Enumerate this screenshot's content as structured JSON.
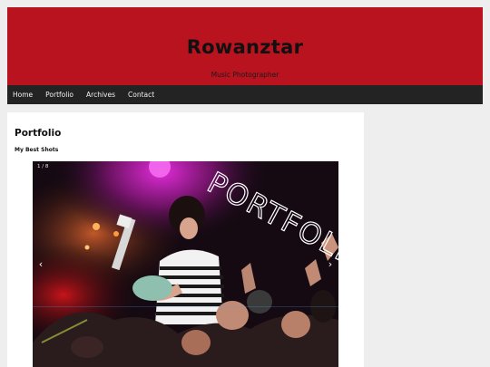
{
  "site": {
    "title": "Rowanztar",
    "tagline": "Music Photographer"
  },
  "nav": {
    "items": [
      {
        "label": "Home"
      },
      {
        "label": "Portfolio"
      },
      {
        "label": "Archives"
      },
      {
        "label": "Contact"
      }
    ]
  },
  "page": {
    "title": "Portfolio",
    "subtitle": "My Best Shots"
  },
  "slider": {
    "counter": "1 / 8",
    "prev_icon": "‹",
    "next_icon": "›",
    "overlay_text": "PORTFOLIO"
  },
  "colors": {
    "header_bg": "#b8131f",
    "nav_bg": "#232323",
    "page_bg": "#eeeeee"
  }
}
